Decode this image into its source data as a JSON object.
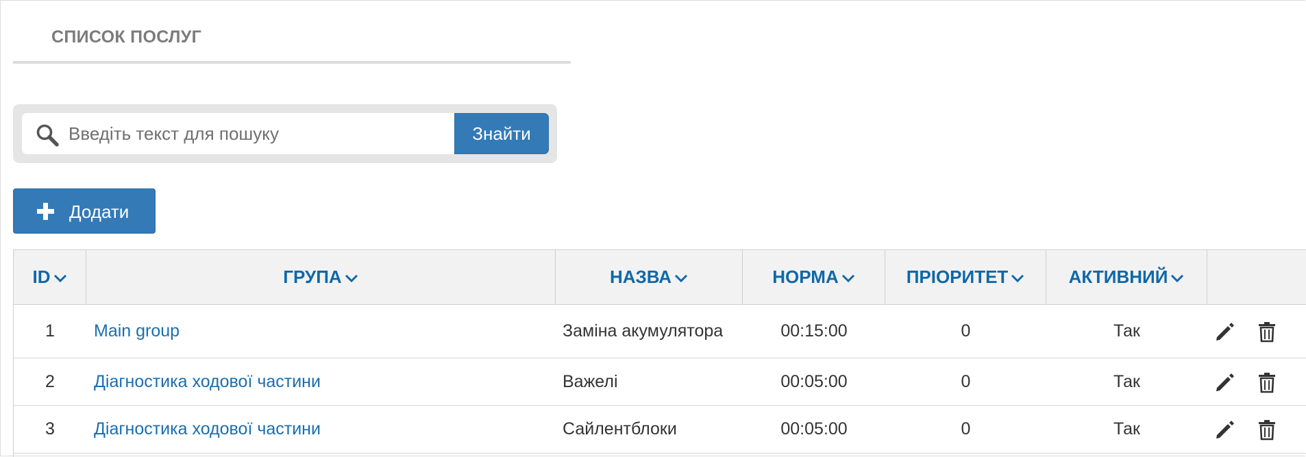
{
  "page": {
    "title": "СПИСОК ПОСЛУГ"
  },
  "search": {
    "placeholder": "Введіть текст для пошуку",
    "value": "",
    "button_label": "Знайти",
    "icon": "search-icon"
  },
  "toolbar": {
    "add_label": "Додати",
    "add_icon": "plus-icon"
  },
  "colors": {
    "accent": "#337ab7",
    "link": "#1a6eb0",
    "header_text": "#0f68a9"
  },
  "table": {
    "columns": [
      {
        "label": "ID"
      },
      {
        "label": "ГРУПА"
      },
      {
        "label": "НАЗВА"
      },
      {
        "label": "НОРМА"
      },
      {
        "label": "ПРІОРИТЕТ"
      },
      {
        "label": "АКТИВНИЙ"
      }
    ],
    "rows": [
      {
        "id": "1",
        "group": "Main group",
        "name": "Заміна акумулятора",
        "norm": "00:15:00",
        "priority": "0",
        "active": "Так"
      },
      {
        "id": "2",
        "group": "Діагностика ходової частини",
        "name": "Важелі",
        "norm": "00:05:00",
        "priority": "0",
        "active": "Так"
      },
      {
        "id": "3",
        "group": "Діагностика ходової частини",
        "name": "Сайлентблоки",
        "norm": "00:05:00",
        "priority": "0",
        "active": "Так"
      }
    ],
    "row_actions": [
      "pencil-icon",
      "trash-icon"
    ]
  }
}
